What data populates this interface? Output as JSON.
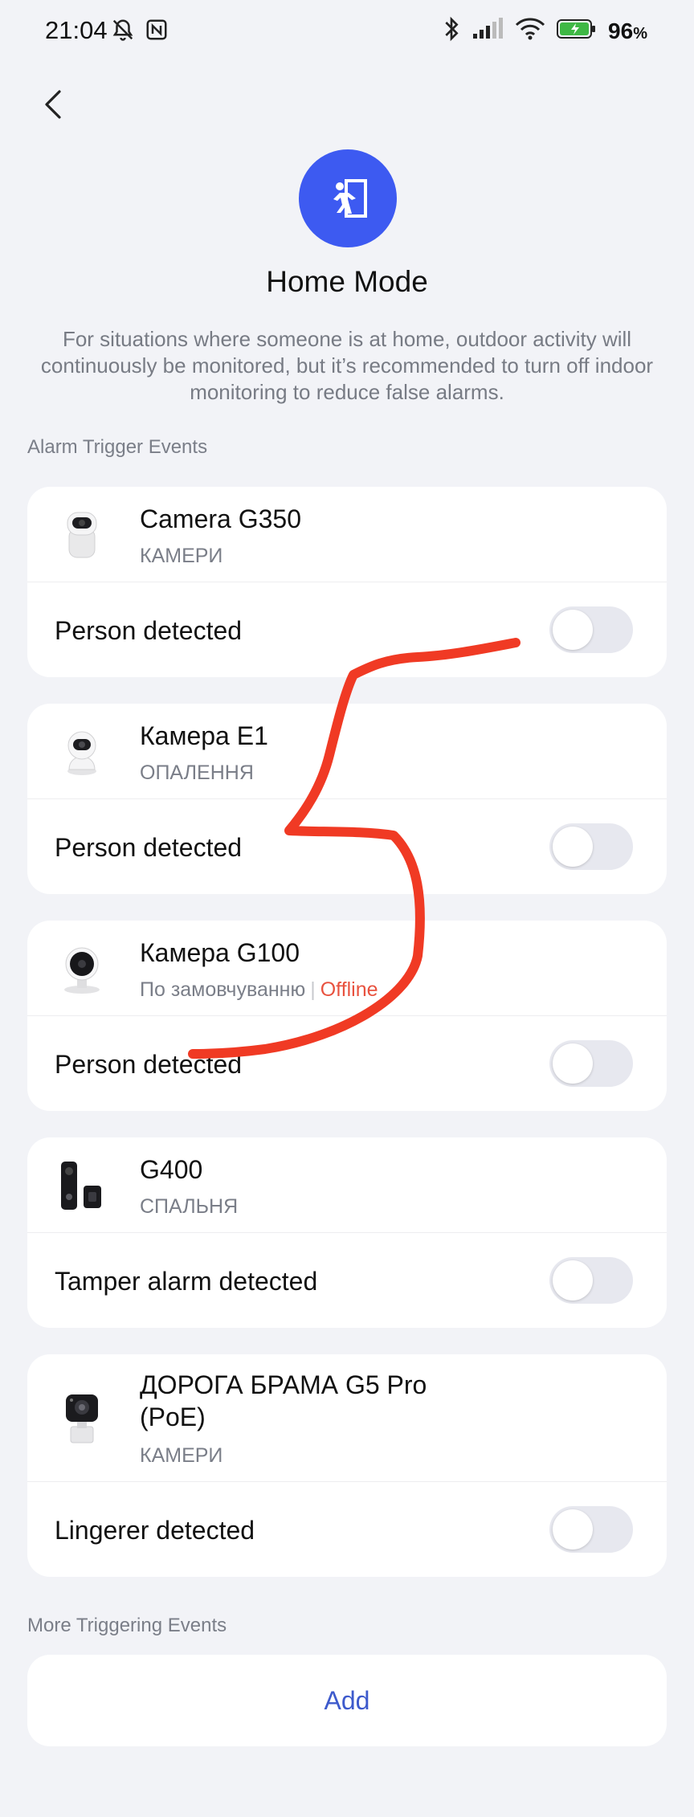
{
  "status_bar": {
    "time": "21:04",
    "battery": "96",
    "battery_unit": "%",
    "icons": [
      "bell-off-icon",
      "nfc-icon",
      "bluetooth-icon",
      "signal-icon",
      "wifi-icon",
      "battery-charging-icon"
    ]
  },
  "header": {
    "title": "Home Mode",
    "description": "For situations where someone is at home, outdoor activity will continuously be monitored, but it’s recommended to turn off indoor monitoring to reduce false alarms.",
    "mode_icon": "person-exit-door-icon"
  },
  "sections": {
    "alarm_trigger": "Alarm Trigger Events",
    "more_triggering": "More Triggering Events"
  },
  "devices": [
    {
      "name": "Camera G350",
      "location": "КАМЕРИ",
      "event": "Person detected",
      "enabled": false
    },
    {
      "name": "Камера E1",
      "location": "ОПАЛЕННЯ",
      "event": "Person detected",
      "enabled": false
    },
    {
      "name": "Камера G100",
      "location": "По замовчуванню",
      "status": "Offline",
      "event": "Person detected",
      "enabled": false
    },
    {
      "name": "G400",
      "location": "СПАЛЬНЯ",
      "event": "Tamper alarm detected",
      "enabled": false
    },
    {
      "name": "ДОРОГА БРАМА G5 Pro (PoE)",
      "location": "КАМЕРИ",
      "event": "Lingerer detected",
      "enabled": false
    }
  ],
  "add_button": {
    "label": "Add"
  },
  "colors": {
    "accent": "#3d5af1",
    "offline": "#e8523f",
    "scribble": "#f03a24",
    "background": "#f2f3f7"
  }
}
